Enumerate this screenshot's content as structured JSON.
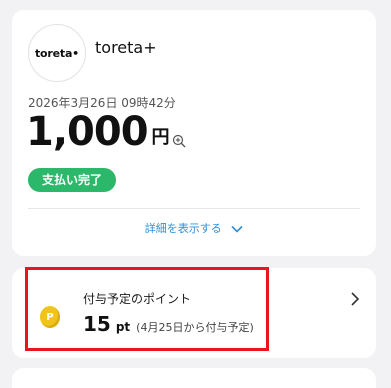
{
  "merchant": {
    "logo_text": "toreta•",
    "name": "toreta+"
  },
  "transaction": {
    "datetime": "2026年3月26日 09時42分",
    "amount": "1,000",
    "currency": "円",
    "status": "支払い完了",
    "details_label": "詳細を表示する"
  },
  "points": {
    "title": "付与予定のポイント",
    "value": "15",
    "unit": "pt",
    "note": "(4月25日から付与予定)",
    "coin_letter": "P"
  },
  "colors": {
    "status_badge": "#2cb86a",
    "link": "#2f8fd6",
    "highlight_border": "#e8141e",
    "coin": "#f0c419"
  }
}
